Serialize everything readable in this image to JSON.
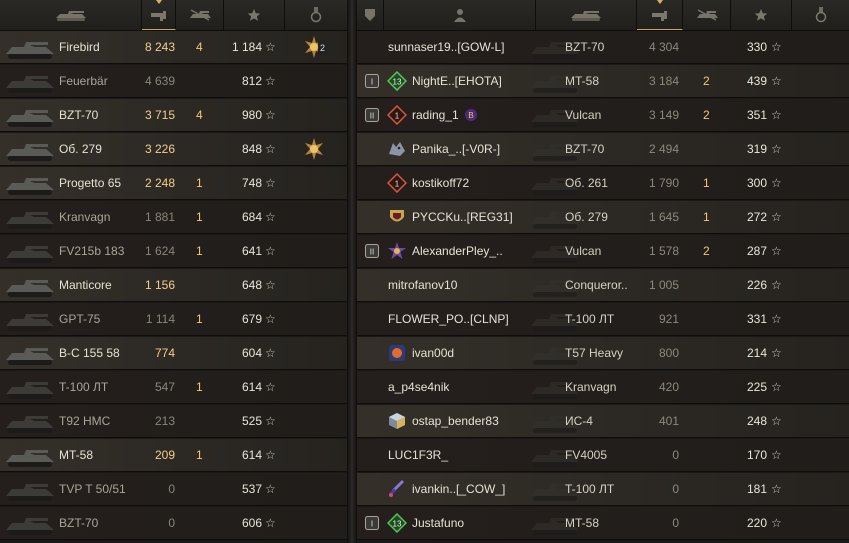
{
  "left_header": [
    "vehicle-icon",
    "damage-icon",
    "frags-icon",
    "xp-star-icon",
    "medal-icon"
  ],
  "right_header": [
    "rank-icon",
    "player-icon",
    "vehicle-icon",
    "damage-icon",
    "frags-icon",
    "xp-star-icon",
    "medal-icon"
  ],
  "colors": {
    "damage_high": "#f1cf8e",
    "damage_low": "#8a8578",
    "frags": "#f0c878",
    "sort_accent": "#d8b060"
  },
  "left_rows": [
    {
      "vehicle": "Firebird",
      "damage": "8 243",
      "frags": "4",
      "xp": "1 184",
      "star": "☆",
      "bright": true,
      "medal": "medal-icon",
      "medal_count": "2"
    },
    {
      "vehicle": "Feuerbär",
      "damage": "4 639",
      "frags": "",
      "xp": "812",
      "star": "☆",
      "bright": false
    },
    {
      "vehicle": "BZT-70",
      "damage": "3 715",
      "frags": "4",
      "xp": "980",
      "star": "☆",
      "bright": true
    },
    {
      "vehicle": "Об. 279",
      "damage": "3 226",
      "frags": "",
      "xp": "848",
      "star": "☆",
      "bright": true,
      "medal": "medal-icon"
    },
    {
      "vehicle": "Progetto 65",
      "damage": "2 248",
      "frags": "1",
      "xp": "748",
      "star": "☆",
      "bright": true
    },
    {
      "vehicle": "Kranvagn",
      "damage": "1 881",
      "frags": "1",
      "xp": "684",
      "star": "☆",
      "bright": false
    },
    {
      "vehicle": "FV215b 183",
      "damage": "1 624",
      "frags": "1",
      "xp": "641",
      "star": "☆",
      "bright": false
    },
    {
      "vehicle": "Manticore",
      "damage": "1 156",
      "frags": "",
      "xp": "648",
      "star": "☆",
      "bright": true
    },
    {
      "vehicle": "GPT-75",
      "damage": "1 114",
      "frags": "1",
      "xp": "679",
      "star": "☆",
      "bright": false
    },
    {
      "vehicle": "B-C 155 58",
      "damage": "774",
      "frags": "",
      "xp": "604",
      "star": "☆",
      "bright": true
    },
    {
      "vehicle": "T-100 ЛТ",
      "damage": "547",
      "frags": "1",
      "xp": "614",
      "star": "☆",
      "bright": false
    },
    {
      "vehicle": "T92 HMC",
      "damage": "213",
      "frags": "",
      "xp": "525",
      "star": "☆",
      "bright": false
    },
    {
      "vehicle": "MT-58",
      "damage": "209",
      "frags": "1",
      "xp": "614",
      "star": "☆",
      "bright": true
    },
    {
      "vehicle": "TVP T 50/51",
      "damage": "0",
      "frags": "",
      "xp": "537",
      "star": "☆",
      "bright": false
    },
    {
      "vehicle": "BZT-70",
      "damage": "0",
      "frags": "",
      "xp": "606",
      "star": "☆",
      "bright": false
    }
  ],
  "right_rows": [
    {
      "rank": "",
      "clan": "",
      "player": "sunnaser19..[GOW-L]",
      "vehicle": "BZT-70",
      "damage": "4 304",
      "frags": "",
      "xp": "330",
      "star": "☆"
    },
    {
      "rank": "I",
      "clan": "13",
      "player": "NightE..[EHOTA]",
      "vehicle": "MT-58",
      "damage": "3 184",
      "frags": "2",
      "xp": "439",
      "star": "☆"
    },
    {
      "rank": "II",
      "clan": "1",
      "player": "rading_1",
      "vehicle": "Vulcan",
      "damage": "3 149",
      "frags": "2",
      "xp": "351",
      "star": "☆",
      "extra_badge": "B"
    },
    {
      "rank": "",
      "clan": "wolf",
      "player": "Panika_..[-V0R-]",
      "vehicle": "BZT-70",
      "damage": "2 494",
      "frags": "",
      "xp": "319",
      "star": "☆"
    },
    {
      "rank": "",
      "clan": "1",
      "player": "kostikoff72",
      "vehicle": "Об. 261",
      "damage": "1 790",
      "frags": "1",
      "xp": "300",
      "star": "☆"
    },
    {
      "rank": "",
      "clan": "shield",
      "player": "PYCCKu..[REG31]",
      "vehicle": "Об. 279",
      "damage": "1 645",
      "frags": "1",
      "xp": "272",
      "star": "☆"
    },
    {
      "rank": "II",
      "clan": "star",
      "player": "AlexanderPley_..",
      "vehicle": "Vulcan",
      "damage": "1 578",
      "frags": "2",
      "xp": "287",
      "star": "☆"
    },
    {
      "rank": "",
      "clan": "",
      "player": "mitrofanov10",
      "vehicle": "Conqueror..",
      "damage": "1 005",
      "frags": "",
      "xp": "226",
      "star": "☆"
    },
    {
      "rank": "",
      "clan": "",
      "player": "FLOWER_PO..[CLNP]",
      "vehicle": "T-100 ЛТ",
      "damage": "921",
      "frags": "",
      "xp": "331",
      "star": "☆"
    },
    {
      "rank": "",
      "clan": "orb",
      "player": "ivan00d",
      "vehicle": "T57 Heavy",
      "damage": "800",
      "frags": "",
      "xp": "214",
      "star": "☆"
    },
    {
      "rank": "",
      "clan": "",
      "player": "a_p4se4nik",
      "vehicle": "Kranvagn",
      "damage": "420",
      "frags": "",
      "xp": "225",
      "star": "☆"
    },
    {
      "rank": "",
      "clan": "cube",
      "player": "ostap_bender83",
      "vehicle": "ИС-4",
      "damage": "401",
      "frags": "",
      "xp": "248",
      "star": "☆"
    },
    {
      "rank": "",
      "clan": "",
      "player": "LUC1F3R_",
      "vehicle": "FV4005",
      "damage": "0",
      "frags": "",
      "xp": "170",
      "star": "☆"
    },
    {
      "rank": "",
      "clan": "dagger",
      "player": "ivankin..[_COW_]",
      "vehicle": "T-100 ЛТ",
      "damage": "0",
      "frags": "",
      "xp": "181",
      "star": "☆"
    },
    {
      "rank": "I",
      "clan": "13",
      "player": "Justafuno",
      "vehicle": "MT-58",
      "damage": "0",
      "frags": "",
      "xp": "220",
      "star": "☆"
    }
  ]
}
